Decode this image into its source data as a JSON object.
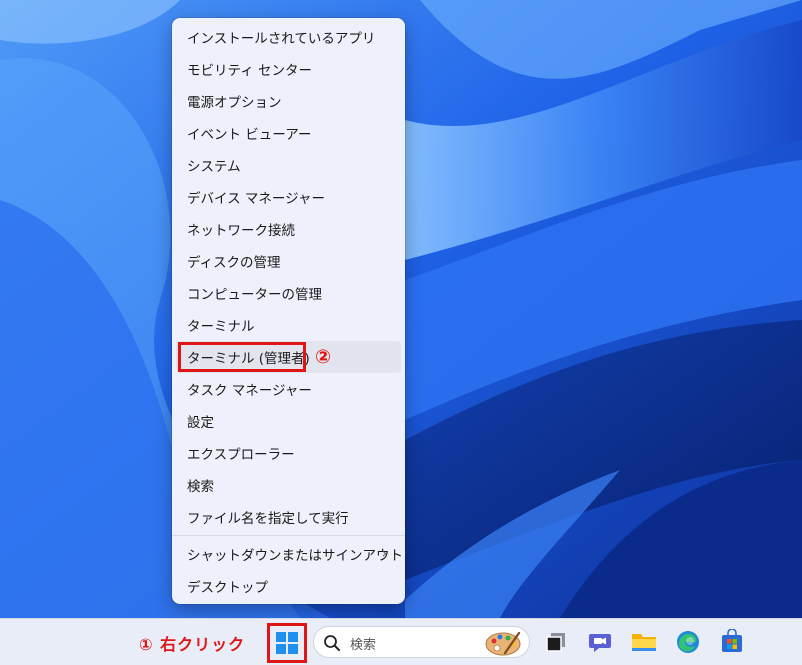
{
  "context_menu": {
    "items": [
      {
        "label": "インストールされているアプリ"
      },
      {
        "label": "モビリティ センター"
      },
      {
        "label": "電源オプション"
      },
      {
        "label": "イベント ビューアー"
      },
      {
        "label": "システム"
      },
      {
        "label": "デバイス マネージャー"
      },
      {
        "label": "ネットワーク接続"
      },
      {
        "label": "ディスクの管理"
      },
      {
        "label": "コンピューターの管理"
      },
      {
        "label": "ターミナル"
      },
      {
        "label": "ターミナル (管理者)"
      },
      {
        "label": "タスク マネージャー"
      },
      {
        "label": "設定"
      },
      {
        "label": "エクスプローラー"
      },
      {
        "label": "検索"
      },
      {
        "label": "ファイル名を指定して実行"
      },
      {
        "label": "シャットダウンまたはサインアウト"
      },
      {
        "label": "デスクトップ"
      }
    ],
    "submenu_chevron": "›"
  },
  "annotations": {
    "step1": "① 右クリック",
    "step2": "②"
  },
  "taskbar": {
    "search_placeholder": "検索",
    "icons": [
      "windows-start-icon",
      "search-icon",
      "palette-icon",
      "task-view-icon",
      "chat-icon",
      "file-explorer-icon",
      "edge-icon",
      "store-icon"
    ]
  },
  "colors": {
    "annotation_red": "#e01515",
    "menu_bg": "#eef0fb",
    "taskbar_bg": "#e8edf8",
    "wallpaper_blue": "#1a5ce0"
  }
}
